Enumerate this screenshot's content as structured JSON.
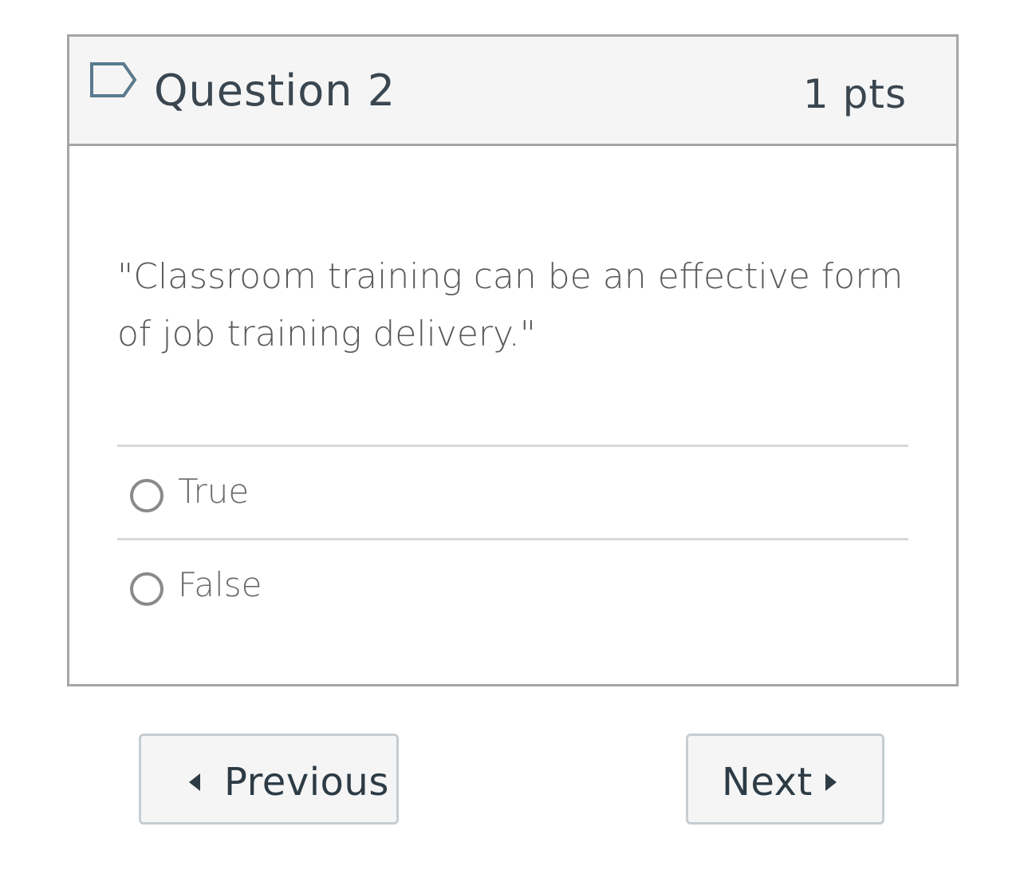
{
  "question": {
    "title": "Question 2",
    "points": "1 pts",
    "flag_icon": "flag-icon",
    "text": "\"Classroom training can be an effective form of job training delivery.\"",
    "answers": [
      {
        "label": "True",
        "selected": false
      },
      {
        "label": "False",
        "selected": false
      }
    ]
  },
  "navigation": {
    "previous_label": "Previous",
    "next_label": "Next"
  },
  "colors": {
    "border": "#a5a5a5",
    "header_bg": "#f5f5f5",
    "text_dark": "#2d3b45",
    "flag_stroke": "#5a7a8e"
  }
}
